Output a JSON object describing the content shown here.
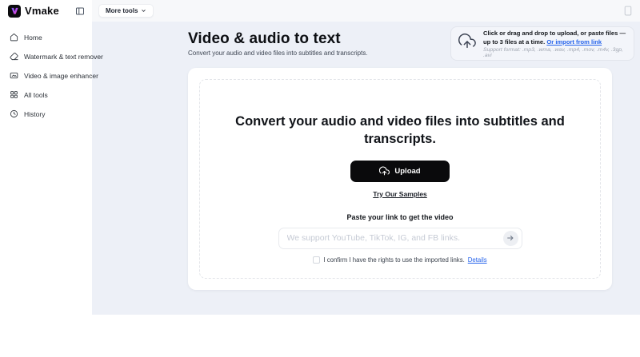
{
  "brand": {
    "name": "Vmake"
  },
  "topbar": {
    "more_tools_label": "More tools"
  },
  "sidebar": {
    "items": [
      {
        "label": "Home",
        "icon": "home-icon"
      },
      {
        "label": "Watermark & text remover",
        "icon": "eraser-icon"
      },
      {
        "label": "Video & image enhancer",
        "icon": "enhancer-icon"
      },
      {
        "label": "All tools",
        "icon": "grid-icon"
      },
      {
        "label": "History",
        "icon": "history-icon"
      }
    ]
  },
  "header": {
    "title": "Video & audio to text",
    "subtitle": "Convert your audio and video files into subtitles and transcripts."
  },
  "upload_hint": {
    "text": "Click or drag and drop to upload, or paste files — up to 3 files at a time. ",
    "link_label": "Or import from link",
    "support": "Support format: .mp3, .wma, .wav, .mp4, .mov, .m4v, .3gp, .avi"
  },
  "card": {
    "headline": "Convert your audio and video files into subtitles and transcripts.",
    "upload_label": "Upload",
    "samples_label": "Try Our Samples",
    "paste_label": "Paste your link to get the video",
    "input_placeholder": "We support YouTube, TikTok, IG, and FB links.",
    "input_value": "",
    "confirm_text": "I confirm I have the rights to use the imported links.",
    "details_label": "Details"
  },
  "colors": {
    "accent_link": "#2563eb",
    "button_bg": "#0a0a0c",
    "main_bg": "#edf0f7",
    "logo_gradient_start": "#7c5cf6",
    "logo_gradient_end": "#f0459e"
  }
}
